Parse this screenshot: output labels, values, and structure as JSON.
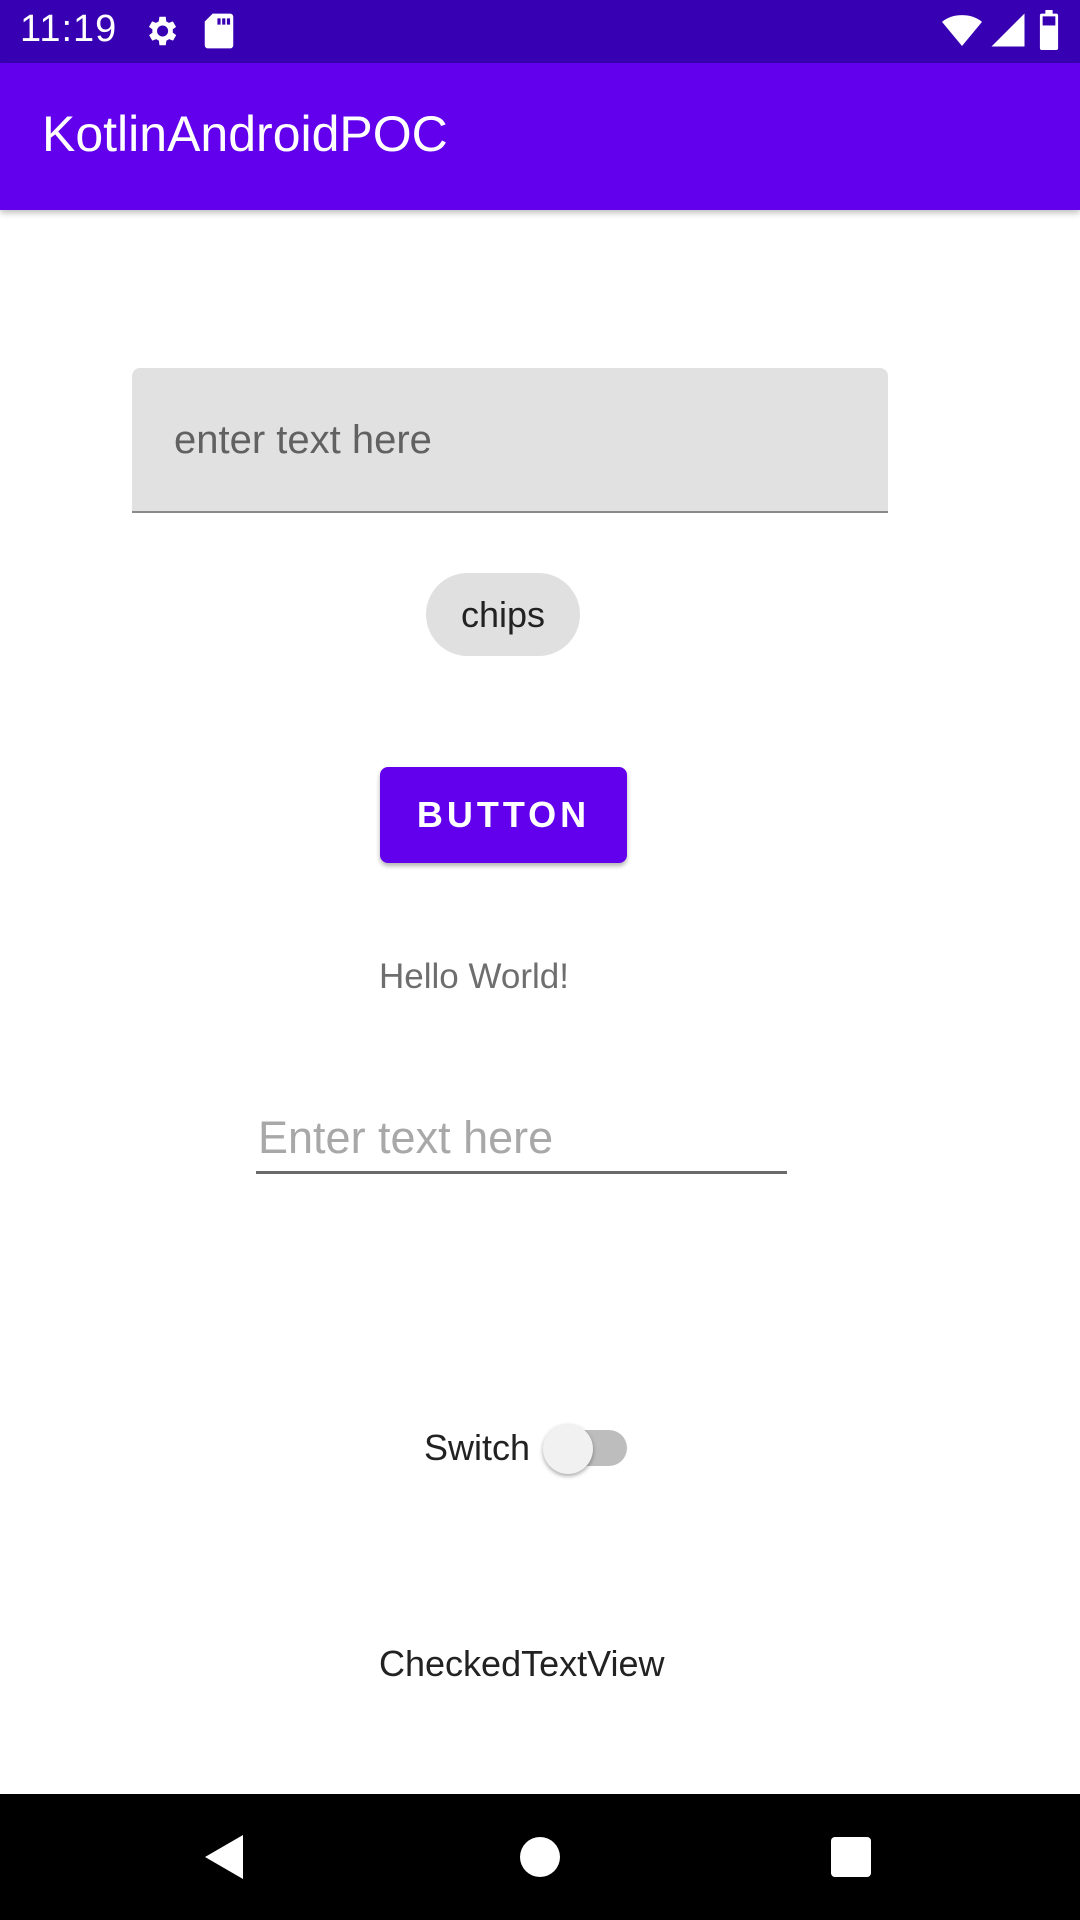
{
  "status_bar": {
    "time": "11:19",
    "icons": [
      "gear-icon",
      "sd-card-icon",
      "wifi-icon",
      "signal-icon",
      "battery-icon"
    ]
  },
  "app_bar": {
    "title": "KotlinAndroidPOC"
  },
  "main": {
    "filled_field_placeholder": "enter text here",
    "chip_label": "chips",
    "button_label": "BUTTON",
    "hello_text": "Hello World!",
    "edit_field_placeholder": "Enter text here",
    "switch_label": "Switch",
    "switch_on": false,
    "checked_text": "CheckedTextView"
  },
  "nav_bar": {
    "icons": [
      "back-icon",
      "home-icon",
      "recents-icon"
    ]
  },
  "colors": {
    "status_bar": "#3700B3",
    "primary": "#6200EE",
    "field_bg": "#E1E1E1",
    "chip_bg": "#E0E0E0"
  }
}
